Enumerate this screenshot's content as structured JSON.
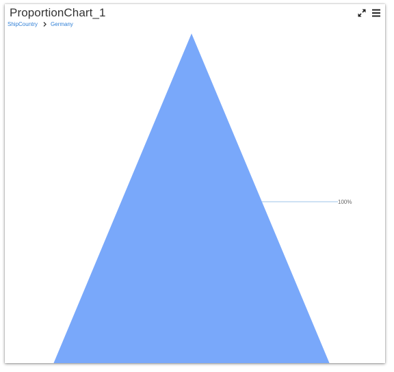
{
  "widget": {
    "title": "ProportionChart_1"
  },
  "breadcrumb": {
    "items": [
      "ShipCountry",
      "Germany"
    ]
  },
  "toolbar": {
    "expand_icon": "expand-icon",
    "menu_icon": "hamburger-menu-icon"
  },
  "chart_data": {
    "type": "pyramid",
    "segments": [
      {
        "label": "100%",
        "value": 100,
        "color": "#79a8fa"
      }
    ],
    "title": "",
    "legend": "none",
    "data_label_line_color": "#9ec3ea"
  }
}
